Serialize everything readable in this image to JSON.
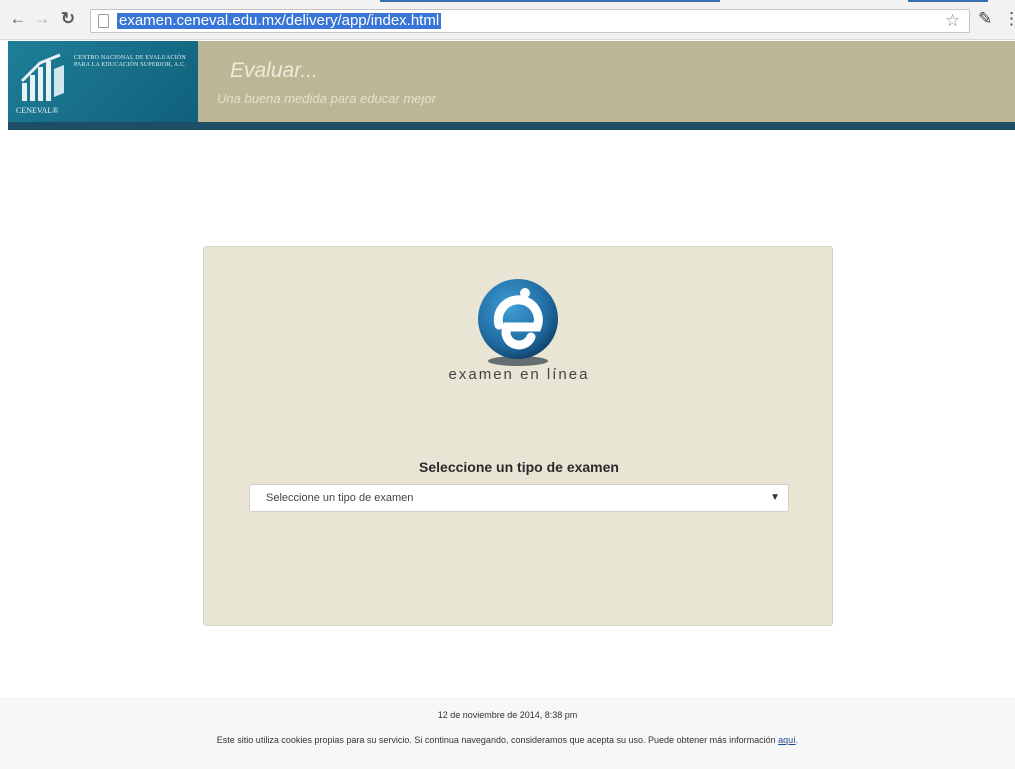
{
  "browser": {
    "url": "examen.ceneval.edu.mx/delivery/app/index.html",
    "icons": [
      "back-arrow-icon",
      "forward-arrow-icon",
      "reload-icon",
      "page-icon",
      "star-icon",
      "eyedropper-icon",
      "menu-icon"
    ]
  },
  "header": {
    "logo_text": "CENTRO NACIONAL DE EVALUACIÓN PARA LA EDUCACIÓN SUPERIOR, A.C.",
    "logo_name": "CENEVAL®",
    "title": "Evaluar...",
    "subtitle": "Una buena medida para educar mejor"
  },
  "main": {
    "logo_text": "examen en línea",
    "select_title": "Seleccione un tipo de examen",
    "select_value": "Seleccione un tipo de examen"
  },
  "footer": {
    "date": "12 de noviembre de 2014, 8:38 pm",
    "cookie_text": "Este sitio utiliza cookies propias para su servicio. Si continua navegando, consideramos que acepta su uso. Puede obtener más información",
    "cookie_link": "aquí"
  },
  "colors": {
    "header_bg": "#bdb696",
    "logo_bg": "#1f7f97",
    "header_bar": "#1d4e66",
    "panel_bg": "#e9e5d5",
    "url_highlight": "#3875d7"
  }
}
